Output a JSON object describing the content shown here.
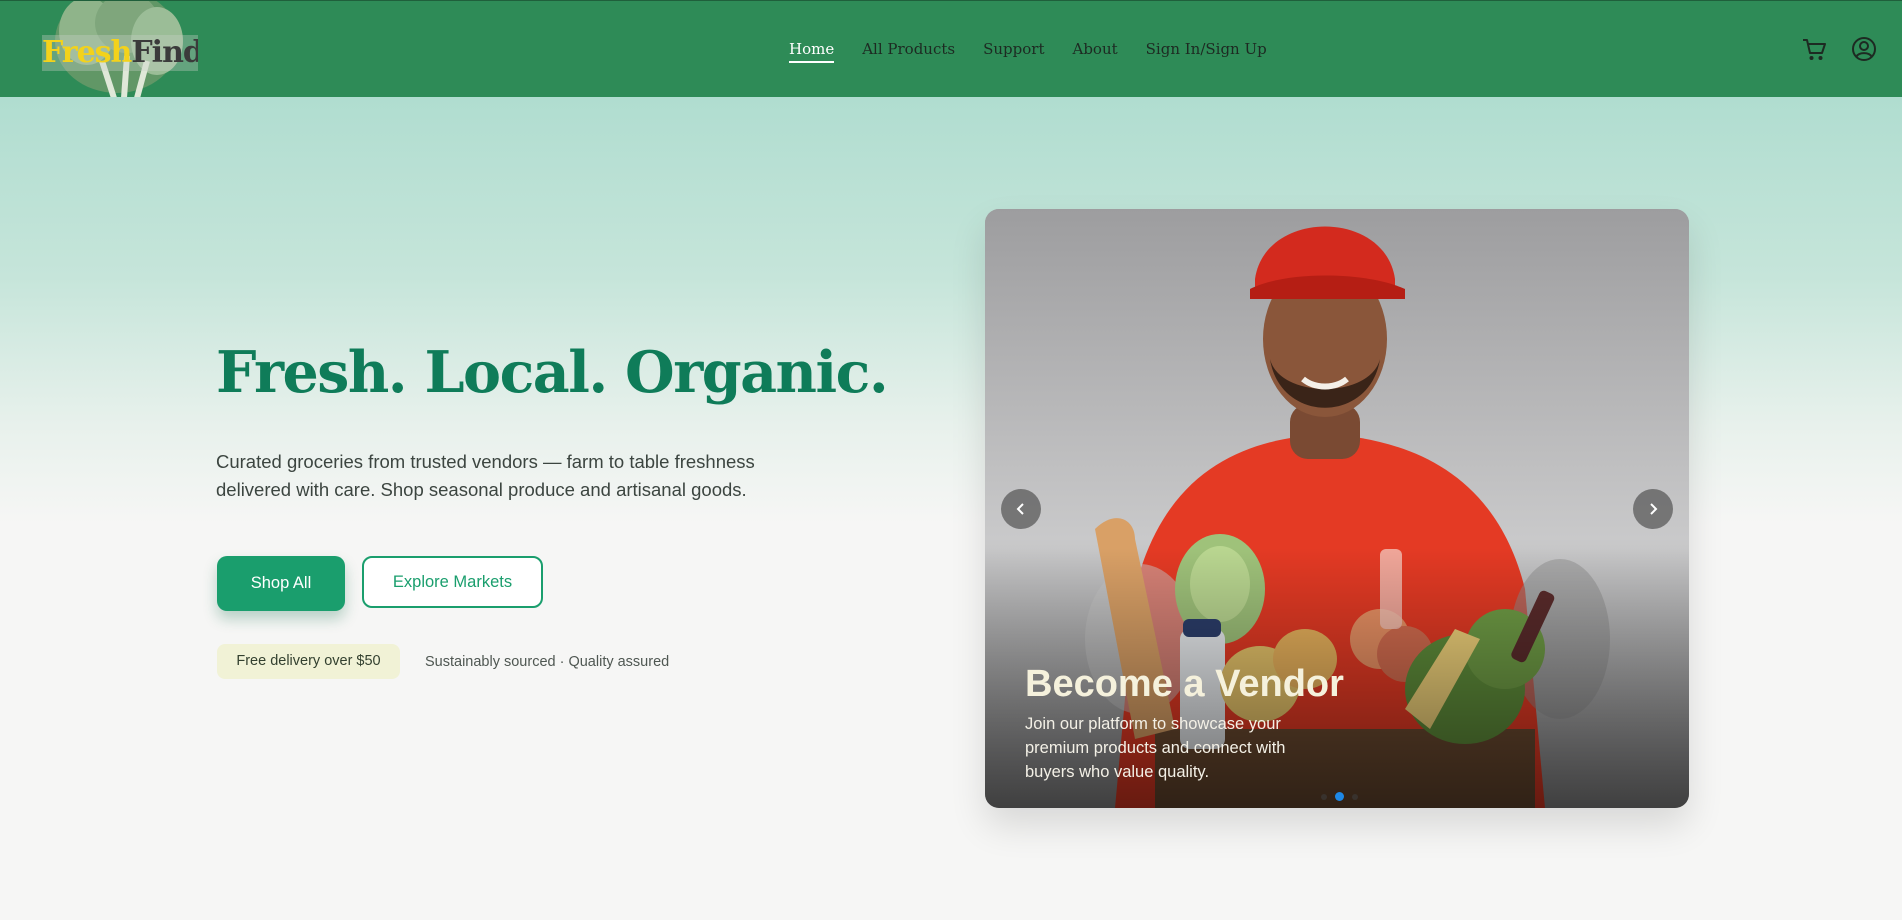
{
  "brand": {
    "part1": "Fresh",
    "part2": "Finds",
    "fresh_color": "#f3d21b"
  },
  "nav": {
    "links": [
      {
        "label": "Home",
        "active": true
      },
      {
        "label": "All Products",
        "active": false
      },
      {
        "label": "Support",
        "active": false
      },
      {
        "label": "About",
        "active": false
      },
      {
        "label": "Sign In/Sign Up",
        "active": false
      }
    ],
    "icons": [
      "cart-icon",
      "user-account-icon"
    ],
    "background": "#2e8b57"
  },
  "hero": {
    "headline": "Fresh. Local. Organic.",
    "headline_color": "#0f7c59",
    "description": "Curated groceries from trusted vendors — farm to table freshness delivered with care. Shop seasonal produce and artisanal goods.",
    "primary_button": "Shop All",
    "secondary_button": "Explore Markets",
    "badge": "Free delivery over $50",
    "note": "Sustainably sourced · Quality assured",
    "accent_color": "#1a9e6d"
  },
  "carousel": {
    "slide_title": "Become a Vendor",
    "slide_text": "Join our platform to showcase your premium products and connect with buyers who value quality.",
    "slide_count": 3,
    "active_index": 1,
    "prev_icon": "chevron-left-icon",
    "next_icon": "chevron-right-icon"
  }
}
